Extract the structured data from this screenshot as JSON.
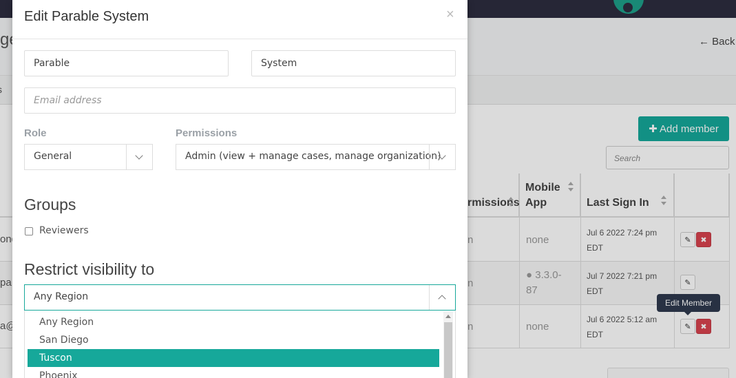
{
  "background": {
    "page_title": "ge",
    "back_label": "← Back",
    "tab_text": "s",
    "add_member_label": "✚ Add member",
    "search_placeholder": "Search",
    "table": {
      "headers": {
        "permissions": "rmissions",
        "mobile_app_line1": "Mobile",
        "mobile_app_line2": "App",
        "last_sign_in": "Last Sign In"
      },
      "rows": [
        {
          "name": "ond",
          "perm": "n",
          "mobile": "none",
          "date1": "Jul 6 2022 7:24 pm",
          "date2": "EDT"
        },
        {
          "name": "pa",
          "perm": "n",
          "mobile": " 3.3.0-",
          "mobile2": "87",
          "date1": "Jul 7 2022 7:21 pm",
          "date2": "EDT"
        },
        {
          "name": "a@",
          "perm": "n",
          "mobile": "none",
          "date1": "Jul 6 2022 5:12 am",
          "date2": "EDT"
        }
      ]
    },
    "tooltip": "Edit Member"
  },
  "modal": {
    "title": "Edit Parable System",
    "close_glyph": "×",
    "first_name": "Parable",
    "last_name": "System",
    "email_placeholder": "Email address",
    "role_label": "Role",
    "role_value": "General",
    "permissions_label": "Permissions",
    "permissions_value": "Admin (view + manage cases, manage organization)",
    "groups_title": "Groups",
    "groups": [
      {
        "label": "Reviewers",
        "checked": false
      }
    ],
    "restrict_title": "Restrict visibility to",
    "region_value": "Any Region",
    "region_options": [
      "Any Region",
      "San Diego",
      "Tuscon",
      "Phoenix"
    ],
    "region_highlighted": "Tuscon"
  },
  "colors": {
    "accent": "#16a89a",
    "danger": "#d9434e",
    "topbar": "#2d2d3f",
    "tooltip": "#2f3a4f"
  }
}
